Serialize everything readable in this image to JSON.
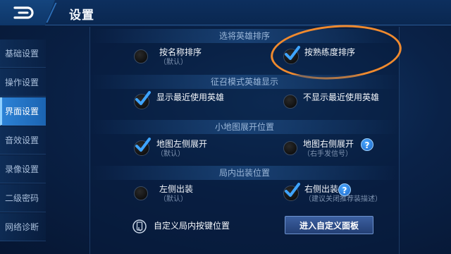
{
  "header": {
    "title": "设置"
  },
  "sidebar": {
    "items": [
      {
        "label": "基础设置",
        "active": false
      },
      {
        "label": "操作设置",
        "active": false
      },
      {
        "label": "界面设置",
        "active": true
      },
      {
        "label": "音效设置",
        "active": false
      },
      {
        "label": "录像设置",
        "active": false
      },
      {
        "label": "二级密码",
        "active": false
      },
      {
        "label": "网络诊断",
        "active": false
      }
    ]
  },
  "sections": {
    "hero_sort": {
      "title": "选将英雄排序",
      "left": {
        "label": "按名称排序",
        "sub": "（默认）",
        "selected": false
      },
      "right": {
        "label": "按熟练度排序",
        "selected": true
      }
    },
    "recruit": {
      "title": "征召模式英雄显示",
      "left": {
        "label": "显示最近使用英雄",
        "selected": true
      },
      "right": {
        "label": "不显示最近使用英雄",
        "selected": false
      }
    },
    "minimap": {
      "title": "小地图展开位置",
      "left": {
        "label": "地图左侧展开",
        "sub": "（默认）",
        "selected": true
      },
      "right": {
        "label": "地图右侧展开",
        "sub": "（右手发信号）",
        "selected": false
      }
    },
    "equipment": {
      "title": "局内出装位置",
      "left": {
        "label": "左侧出装",
        "sub": "（默认）",
        "selected": false
      },
      "right": {
        "label": "右侧出装",
        "sub": "（建议关闭推荐装描述）",
        "selected": true
      }
    },
    "custom": {
      "label": "自定义局内按键位置",
      "button": "进入自定义面板"
    }
  },
  "colors": {
    "accent": "#2c82d6",
    "check": "#3ea4ff",
    "annotation": "#f08a2e"
  }
}
